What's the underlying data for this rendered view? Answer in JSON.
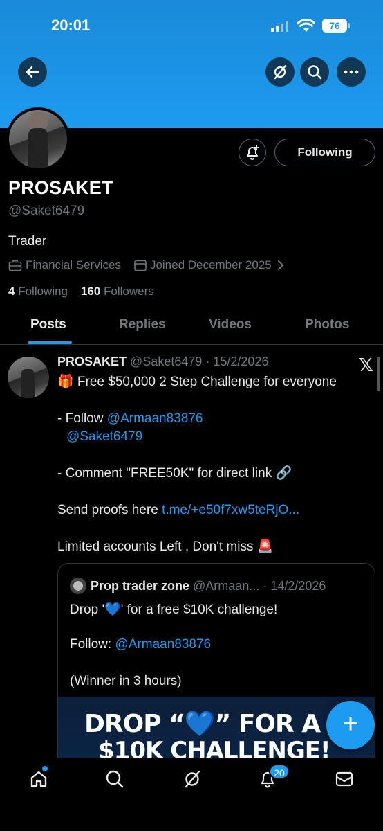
{
  "status_bar": {
    "time": "20:01",
    "battery": "76"
  },
  "profile": {
    "name": "PROSAKET",
    "handle": "@Saket6479",
    "bio": "Trader",
    "category": "Financial Services",
    "joined": "Joined December 2025",
    "following_count": "4",
    "following_label": "Following",
    "followers_count": "160",
    "followers_label": "Followers",
    "follow_button": "Following"
  },
  "tabs": [
    {
      "label": "Posts"
    },
    {
      "label": "Replies"
    },
    {
      "label": "Videos"
    },
    {
      "label": "Photos"
    }
  ],
  "post": {
    "author": "PROSAKET",
    "handle": "@Saket6479",
    "date": "· 15/2/2026",
    "line1": "🎁 Free $50,000 2 Step Challenge for everyone",
    "line2_prefix": "- Follow ",
    "mention1": "@Armaan83876",
    "mention2": "@Saket6479",
    "line3": "- Comment \"FREE50K\" for direct link 🔗",
    "line4_prefix": "Send proofs here ",
    "link": "t.me/+e50f7xw5teRjO...",
    "line5": "Limited accounts Left , Don't miss 🚨"
  },
  "quote": {
    "author": "Prop trader zone",
    "handle": "@Armaan...",
    "date": "· 14/2/2026",
    "line1": "Drop '💙' for a free $10K challenge!",
    "line2_prefix": "Follow: ",
    "mention": "@Armaan83876",
    "line3": "(Winner in 3 hours)",
    "image_line1": "DROP “💙” FOR A FR",
    "image_line2": "$10K CHALLENGE!"
  },
  "fab": "+",
  "notifications_badge": "20",
  "colors": {
    "accent": "#1d9bf0",
    "background": "#000000",
    "muted": "#71767b"
  }
}
